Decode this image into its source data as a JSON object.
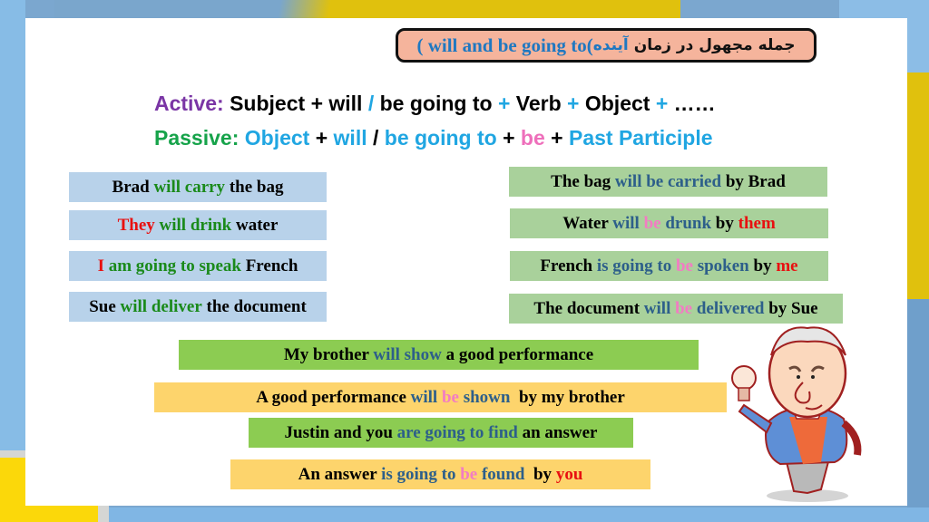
{
  "title": {
    "parts": [
      {
        "text": "( will and be going to",
        "color": "blue"
      },
      {
        "text": "(",
        "color": "blue"
      },
      {
        "text": "آینده",
        "color": "fa-blue"
      },
      {
        "text": " جمله مجهول در زمان",
        "color": "fa"
      }
    ],
    "persian_label": "جمله مجهول در زمان",
    "persian_highlight": "آینده",
    "english_part": "( will and be going to("
  },
  "formulas": {
    "active": {
      "label": "Active:",
      "tokens": [
        "Subject",
        "+",
        "will",
        "/",
        "be going to",
        "+",
        "Verb",
        "+",
        "Object",
        "+",
        "……"
      ]
    },
    "passive": {
      "label": "Passive:",
      "tokens": [
        "Object",
        "+",
        "will",
        "/",
        "be going to",
        "+",
        "be",
        "+",
        "Past Participle"
      ]
    }
  },
  "active_sentences": [
    [
      {
        "t": "Brad ",
        "c": "black"
      },
      {
        "t": "will carry",
        "c": "green"
      },
      {
        "t": " the bag",
        "c": "black"
      }
    ],
    [
      {
        "t": "They",
        "c": "red"
      },
      {
        "t": " will drink",
        "c": "green"
      },
      {
        "t": " water",
        "c": "black"
      }
    ],
    [
      {
        "t": "I",
        "c": "red"
      },
      {
        "t": " am going to speak",
        "c": "green"
      },
      {
        "t": " French",
        "c": "black"
      }
    ],
    [
      {
        "t": "Sue ",
        "c": "black"
      },
      {
        "t": "will deliver",
        "c": "green"
      },
      {
        "t": " the document",
        "c": "black"
      }
    ]
  ],
  "passive_sentences": [
    [
      {
        "t": "The bag ",
        "c": "black"
      },
      {
        "t": "will be carried",
        "c": "navy"
      },
      {
        "t": " by Brad",
        "c": "black"
      }
    ],
    [
      {
        "t": "Water ",
        "c": "black"
      },
      {
        "t": "will ",
        "c": "navy"
      },
      {
        "t": "be",
        "c": "pink"
      },
      {
        "t": " drunk",
        "c": "navy"
      },
      {
        "t": " by ",
        "c": "black"
      },
      {
        "t": "them",
        "c": "red"
      }
    ],
    [
      {
        "t": "French ",
        "c": "black"
      },
      {
        "t": "is going to ",
        "c": "navy"
      },
      {
        "t": "be",
        "c": "pink"
      },
      {
        "t": " spoken",
        "c": "navy"
      },
      {
        "t": " by ",
        "c": "black"
      },
      {
        "t": "me",
        "c": "red"
      }
    ],
    [
      {
        "t": "The document ",
        "c": "black"
      },
      {
        "t": "will ",
        "c": "navy"
      },
      {
        "t": "be",
        "c": "pink"
      },
      {
        "t": " delivered",
        "c": "navy"
      },
      {
        "t": " by Sue",
        "c": "black"
      }
    ]
  ],
  "bottom_sentences": [
    [
      {
        "t": "My brother ",
        "c": "black"
      },
      {
        "t": "will show",
        "c": "navy"
      },
      {
        "t": " a good performance",
        "c": "black"
      }
    ],
    [
      {
        "t": "A good performance ",
        "c": "black"
      },
      {
        "t": "will ",
        "c": "navy"
      },
      {
        "t": "be",
        "c": "pink"
      },
      {
        "t": " shown",
        "c": "navy"
      },
      {
        "t": "  by my brother",
        "c": "black"
      }
    ],
    [
      {
        "t": "Justin and you ",
        "c": "black"
      },
      {
        "t": "are going to find",
        "c": "navy"
      },
      {
        "t": " an answer",
        "c": "black"
      }
    ],
    [
      {
        "t": "An answer ",
        "c": "black"
      },
      {
        "t": "is going to ",
        "c": "navy"
      },
      {
        "t": "be",
        "c": "pink"
      },
      {
        "t": " found",
        "c": "navy"
      },
      {
        "t": "  by ",
        "c": "black"
      },
      {
        "t": "you",
        "c": "red"
      }
    ]
  ],
  "colors": {
    "active_box": "#b8d2ea",
    "passive_box": "#a9d19b",
    "bottom_active_box": "#8ccc52",
    "bottom_passive_box": "#fdd46c",
    "title_box": "#f5b49c"
  },
  "illustration": "cartoon-professor-holding-lightbulb"
}
